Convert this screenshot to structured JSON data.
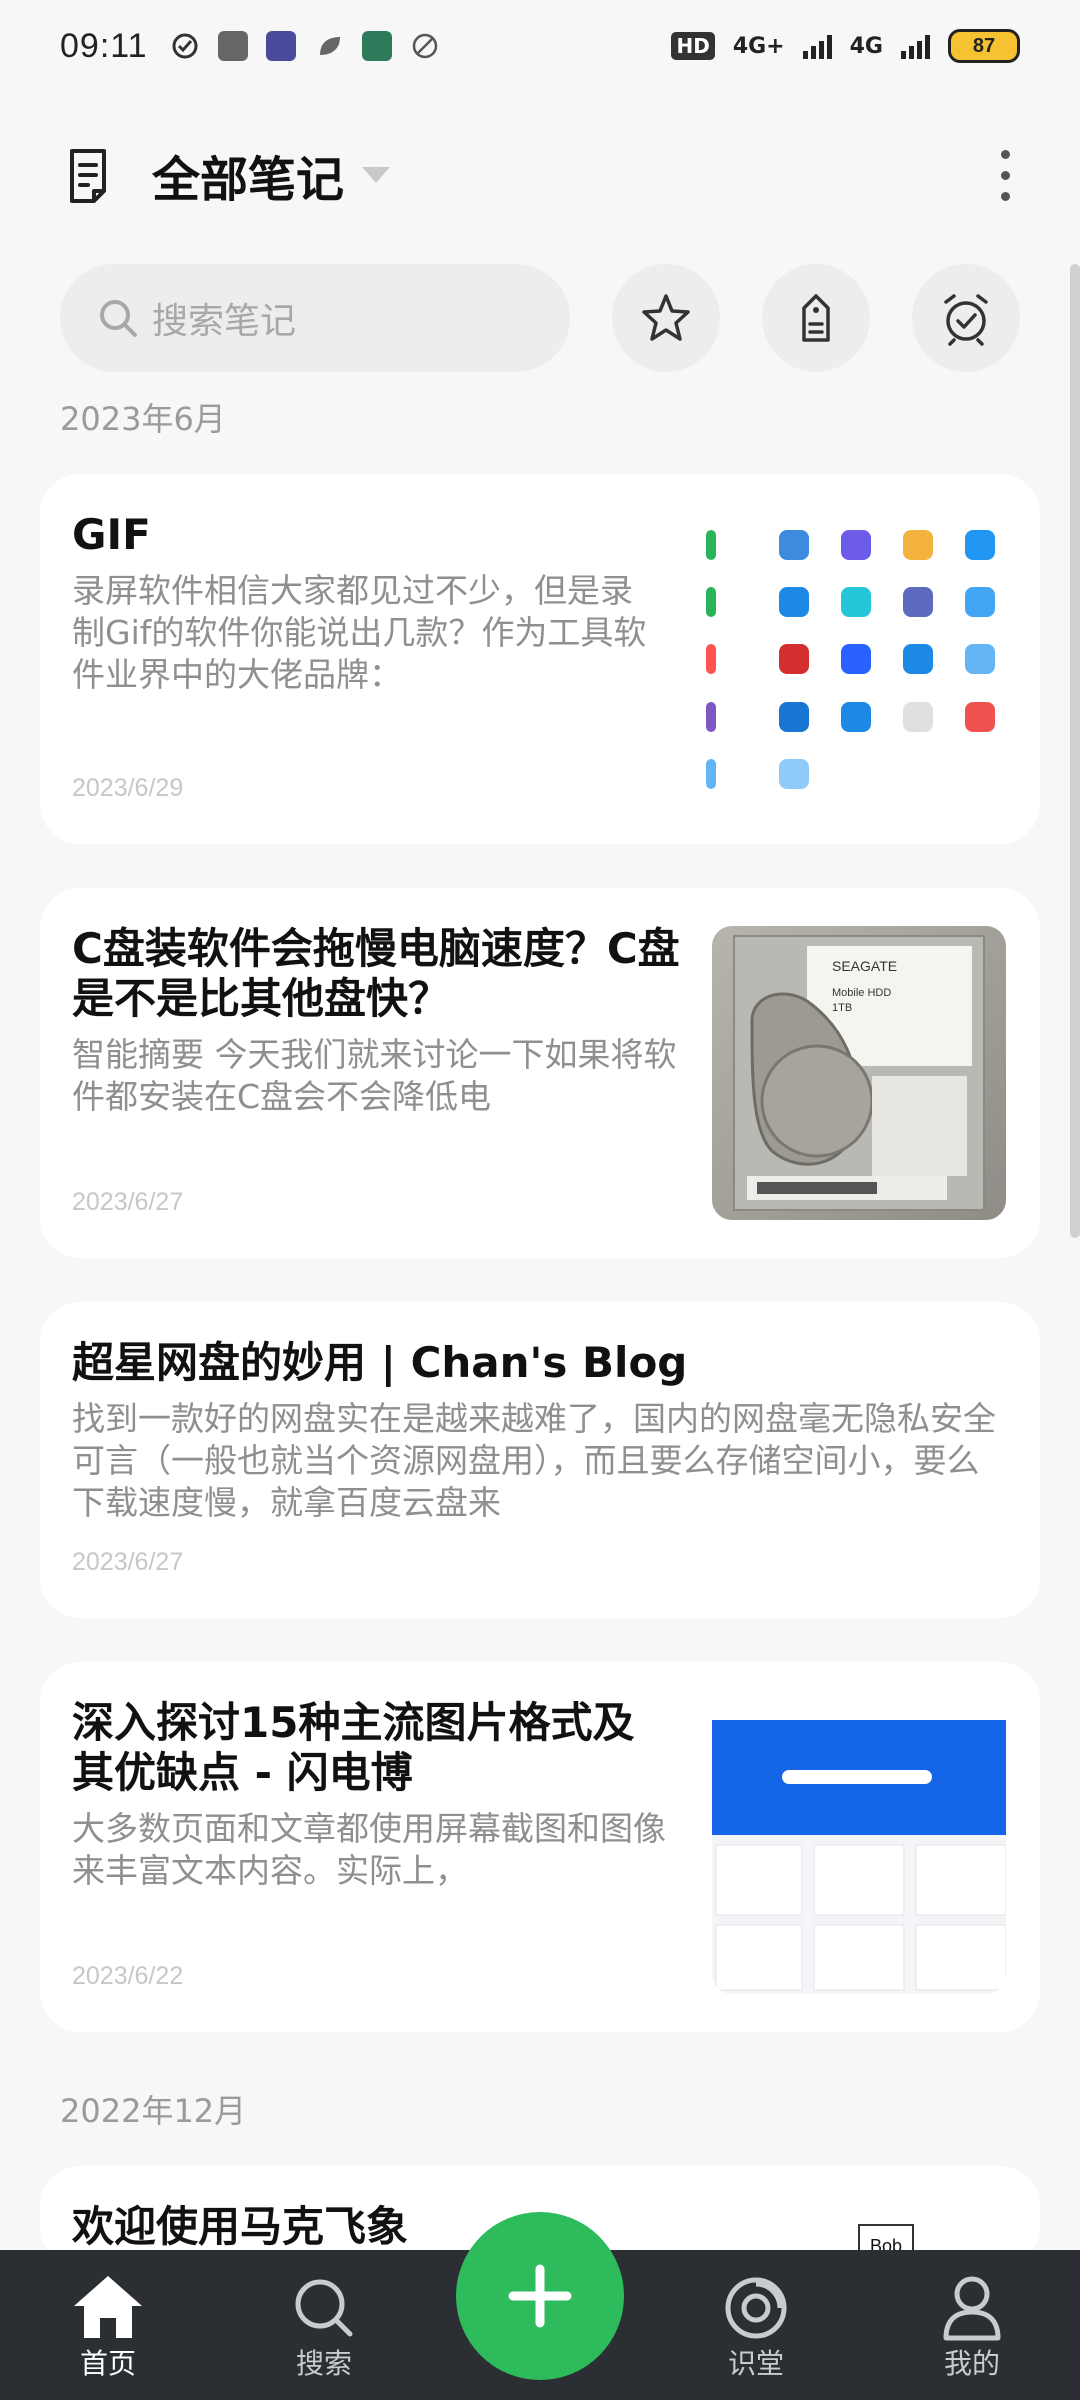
{
  "status_bar": {
    "time": "09:11",
    "network_1": "4G+",
    "network_2": "4G",
    "battery": "87",
    "hd_badge": "HD"
  },
  "header": {
    "title": "全部笔记"
  },
  "search": {
    "placeholder": "搜索笔记"
  },
  "sections": [
    {
      "label": "2023年6月"
    },
    {
      "label": "2022年12月"
    }
  ],
  "notes": [
    {
      "title": "GIF",
      "snippet": "录屏软件相信大家都见过不少，但是录制Gif的软件你能说出几款？作为工具软件业界中的大佬品牌：",
      "date": "2023/6/29"
    },
    {
      "title": "C盘装软件会拖慢电脑速度？C盘是不是比其他盘快？",
      "snippet": "智能摘要 今天我们就来讨论一下如果将软件都安装在C盘会不会降低电",
      "date": "2023/6/27"
    },
    {
      "title": "超星网盘的妙用 | Chan's Blog",
      "snippet": "找到一款好的网盘实在是越来越难了，国内的网盘毫无隐私安全可言（一般也就当个资源网盘用），而且要么存储空间小，要么下载速度慢，就拿百度云盘来",
      "date": "2023/6/27"
    },
    {
      "title": "深入探讨15种主流图片格式及其优缺点 - 闪电博",
      "snippet": "大多数页面和文章都使用屏幕截图和图像来丰富文本内容。实际上，",
      "date": "2023/6/22"
    },
    {
      "title": "欢迎使用马克飞象",
      "snippet": "",
      "date": ""
    }
  ],
  "thumbnail_text": {
    "hdd_brand": "SEAGATE",
    "hdd_model": "Mobile HDD",
    "hdd_size": "1TB",
    "bob": "Bob"
  },
  "bottom_nav": {
    "home": "首页",
    "search": "搜索",
    "learn": "识堂",
    "me": "我的"
  },
  "colors": {
    "accent": "#2dbb5c",
    "nav_bg": "#2b2f33",
    "battery": "#f6c232"
  }
}
